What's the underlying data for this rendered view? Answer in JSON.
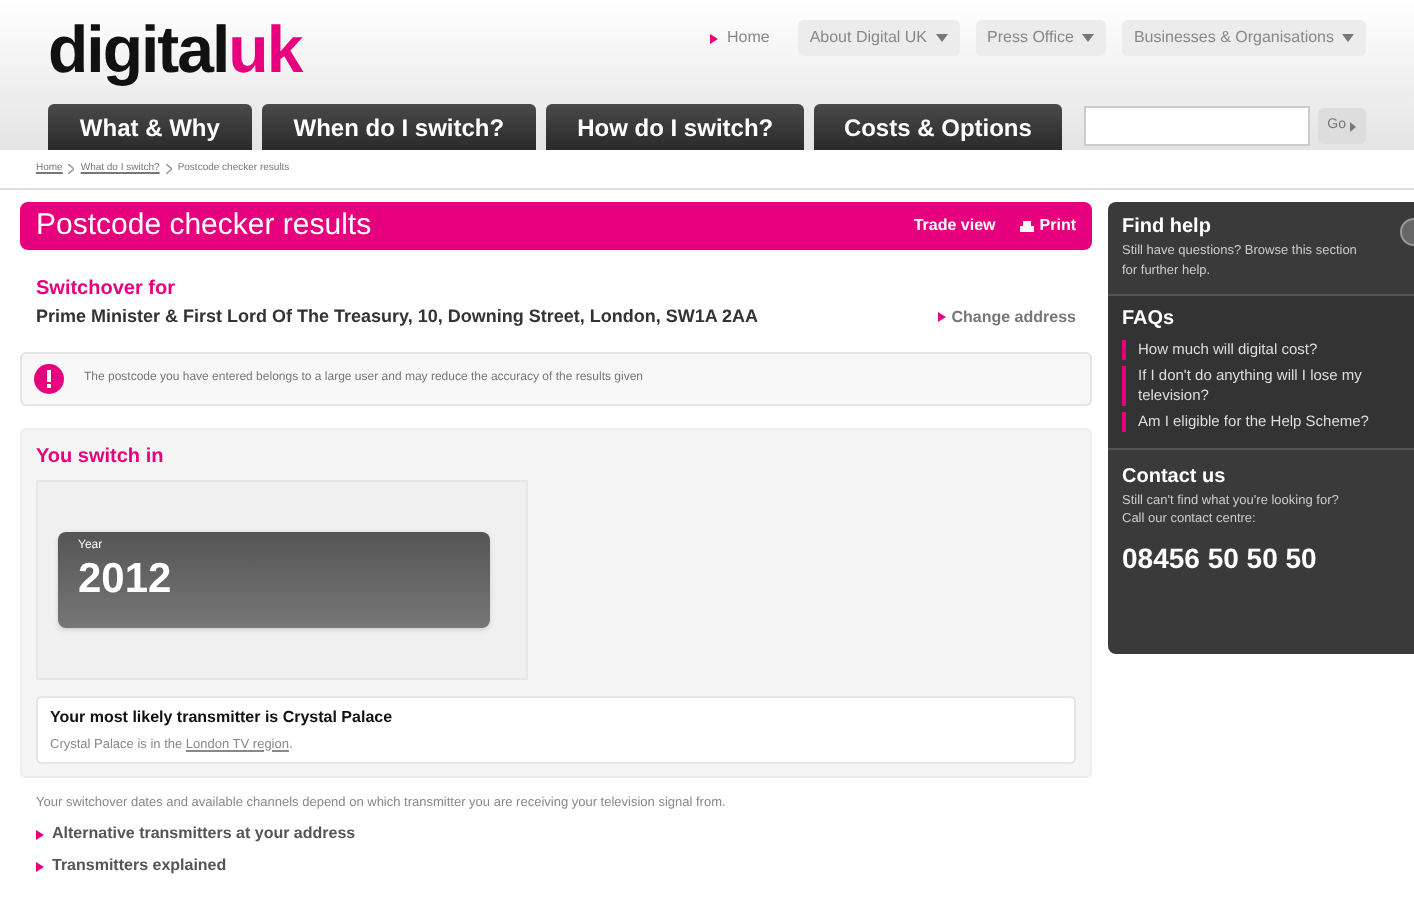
{
  "logo": {
    "first": "digital",
    "second": "uk"
  },
  "top_links": [
    {
      "label": "Home",
      "selected": true,
      "dropdown": false
    },
    {
      "label": "About Digital UK",
      "selected": false,
      "dropdown": true
    },
    {
      "label": "Press Office",
      "selected": false,
      "dropdown": true
    },
    {
      "label": "Businesses & Organisations",
      "selected": false,
      "dropdown": true
    }
  ],
  "nav_tabs": [
    "What & Why",
    "When do I switch?",
    "How do I switch?",
    "Costs & Options"
  ],
  "search": {
    "button": "Go"
  },
  "breadcrumb": [
    {
      "label": "Home",
      "link": true
    },
    {
      "label": "What do I switch?",
      "link": true
    },
    {
      "label": "Postcode checker results",
      "link": false
    }
  ],
  "header": {
    "title": "Postcode checker results",
    "trade_view": "Trade view",
    "print": "Print"
  },
  "switchover": {
    "label": "Switchover for",
    "address": "Prime Minister & First Lord Of The Treasury, 10, Downing Street, London, SW1A 2AA",
    "change": "Change address"
  },
  "notice": "The postcode you have entered belongs to a large user and may reduce the accuracy of the results given",
  "switch_in": {
    "title": "You switch in",
    "year_label": "Year",
    "year": "2012"
  },
  "transmitter": {
    "title": "Your most likely transmitter is Crystal Palace",
    "text_before": "Crystal Palace is in the ",
    "link": "London TV region",
    "text_after": "."
  },
  "footnote": "Your switchover dates and available channels depend on which transmitter you are receiving your television signal from.",
  "links": [
    "Alternative transmitters at your address",
    "Transmitters explained"
  ],
  "sidebar": {
    "find_help": {
      "title": "Find help",
      "text": "Still have questions? Browse this section for further help."
    },
    "faqs": {
      "title": "FAQs",
      "items": [
        "How much will digital cost?",
        "If I don't do anything will I lose my television?",
        "Am I eligible for the Help Scheme?"
      ]
    },
    "contact": {
      "title": "Contact us",
      "text": "Still can't find what you're looking for? Call our contact centre:",
      "phone": "08456 50 50 50"
    }
  }
}
